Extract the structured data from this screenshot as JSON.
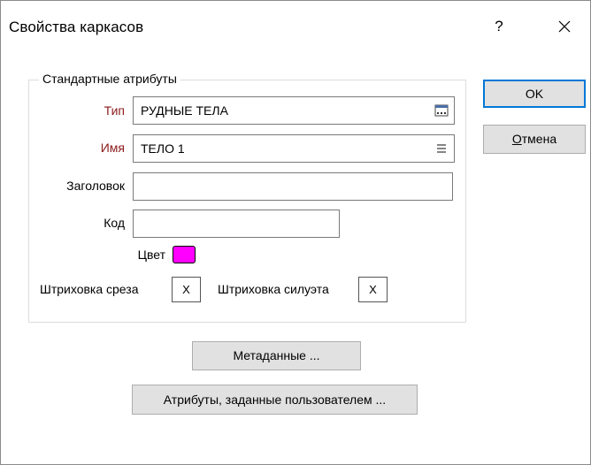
{
  "dialog": {
    "title": "Свойства каркасов",
    "help_label": "?"
  },
  "group": {
    "legend": "Стандартные атрибуты"
  },
  "fields": {
    "type_label": "Тип",
    "type_value": "РУДНЫЕ ТЕЛА",
    "name_label": "Имя",
    "name_value": "ТЕЛО 1",
    "heading_label": "Заголовок",
    "heading_value": "",
    "code_label": "Код",
    "code_value": "",
    "color_label": "Цвет",
    "color_value": "#ff00ff",
    "section_hatch_label": "Штриховка среза",
    "section_hatch_value": "X",
    "silhouette_hatch_label": "Штриховка силуэта",
    "silhouette_hatch_value": "X"
  },
  "buttons": {
    "ok_label": "OK",
    "cancel_first": "О",
    "cancel_rest": "тмена",
    "metadata_label": "Метаданные ...",
    "user_attrs_label": "Атрибуты, заданные пользователем ..."
  },
  "icons": {
    "type_field_icon": "browse-list-icon",
    "name_field_icon": "menu-lines-icon",
    "close": "close-icon"
  },
  "colors": {
    "required_label": "#8b1a1a",
    "default_button_border": "#0078d7",
    "button_face": "#e1e1e1"
  }
}
